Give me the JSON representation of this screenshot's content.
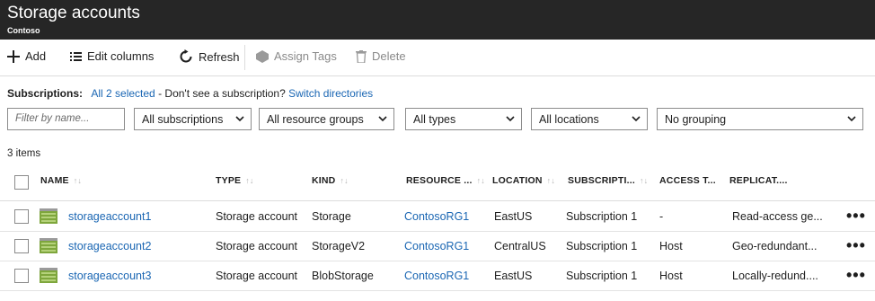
{
  "header": {
    "title": "Storage accounts",
    "subtitle": "Contoso"
  },
  "toolbar": {
    "add": "Add",
    "edit_columns": "Edit columns",
    "refresh": "Refresh",
    "assign_tags": "Assign Tags",
    "delete": "Delete"
  },
  "subscriptions": {
    "label": "Subscriptions:",
    "selected": "All 2 selected",
    "hint": " - Don't see a subscription? ",
    "switch": "Switch directories"
  },
  "filters": {
    "name_placeholder": "Filter by name...",
    "subscriptions": "All subscriptions",
    "resource_groups": "All resource groups",
    "types": "All types",
    "locations": "All locations",
    "grouping": "No grouping"
  },
  "items_count": "3 items",
  "columns": {
    "name": "NAME",
    "type": "TYPE",
    "kind": "KIND",
    "resource": "RESOURCE ...",
    "location": "LOCATION",
    "subscription": "SUBSCRIPTI...",
    "access": "ACCESS T...",
    "replication": "REPLICAT...."
  },
  "rows": [
    {
      "name": "storageaccount1",
      "type": "Storage account",
      "kind": "Storage",
      "resource": "ContosoRG1",
      "location": "EastUS",
      "subscription": "Subscription 1",
      "access": "-",
      "replication": "Read-access ge..."
    },
    {
      "name": "storageaccount2",
      "type": "Storage account",
      "kind": "StorageV2",
      "resource": "ContosoRG1",
      "location": "CentralUS",
      "subscription": "Subscription 1",
      "access": "Host",
      "replication": "Geo-redundant..."
    },
    {
      "name": "storageaccount3",
      "type": "Storage account",
      "kind": "BlobStorage",
      "resource": "ContosoRG1",
      "location": "EastUS",
      "subscription": "Subscription 1",
      "access": "Host",
      "replication": "Locally-redund...."
    }
  ],
  "more_label": "•••",
  "colors": {
    "link": "#1a66b3",
    "header_bg": "#262626",
    "storage_icon": "#7ea63c"
  }
}
